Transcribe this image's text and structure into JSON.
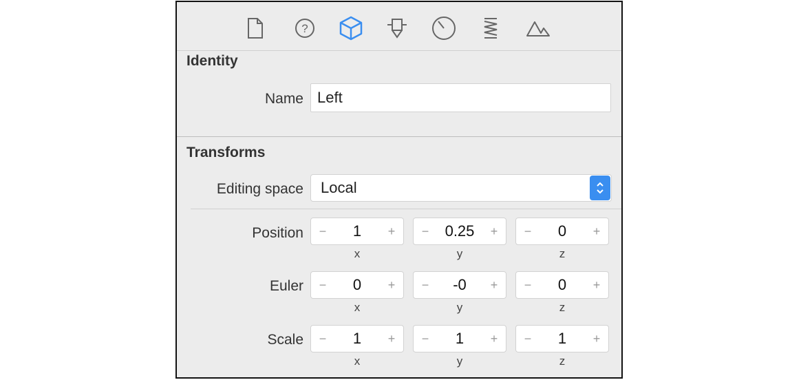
{
  "toolbar": {
    "icons": [
      {
        "name": "file-icon"
      },
      {
        "name": "help-icon"
      },
      {
        "name": "cube-icon"
      },
      {
        "name": "attributes-icon"
      },
      {
        "name": "dial-icon"
      },
      {
        "name": "spring-icon"
      },
      {
        "name": "mountains-icon"
      }
    ],
    "active_color": "#3a8ef0"
  },
  "identity": {
    "title": "Identity",
    "name_label": "Name",
    "name_value": "Left"
  },
  "transforms": {
    "title": "Transforms",
    "editing_space_label": "Editing space",
    "editing_space_value": "Local",
    "position": {
      "label": "Position",
      "x": "1",
      "y": "0.25",
      "z": "0"
    },
    "euler": {
      "label": "Euler",
      "x": "0",
      "y": "-0",
      "z": "0"
    },
    "scale": {
      "label": "Scale",
      "x": "1",
      "y": "1",
      "z": "1"
    },
    "axes": {
      "x": "x",
      "y": "y",
      "z": "z"
    },
    "stepper": {
      "minus": "−",
      "plus": "+"
    }
  }
}
